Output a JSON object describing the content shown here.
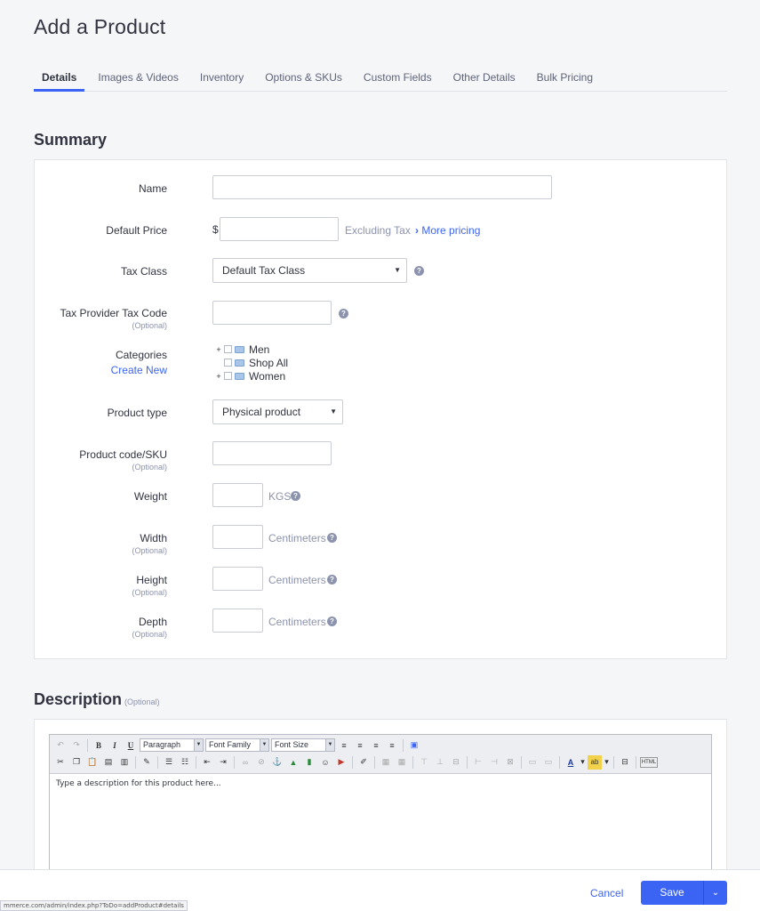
{
  "page": {
    "title": "Add a Product"
  },
  "tabs": [
    "Details",
    "Images & Videos",
    "Inventory",
    "Options & SKUs",
    "Custom Fields",
    "Other Details",
    "Bulk Pricing"
  ],
  "summary": {
    "title": "Summary",
    "name_label": "Name",
    "name_value": "",
    "price_label": "Default Price",
    "currency": "$",
    "price_value": "",
    "excluding_tax": "Excluding Tax",
    "more_pricing": "More pricing",
    "tax_class_label": "Tax Class",
    "tax_class_value": "Default Tax Class",
    "tax_code_label": "Tax Provider Tax Code",
    "optional": "(Optional)",
    "categories_label": "Categories",
    "create_new": "Create New",
    "categories": [
      {
        "name": "Men",
        "expandable": true
      },
      {
        "name": "Shop All",
        "expandable": false
      },
      {
        "name": "Women",
        "expandable": true
      }
    ],
    "product_type_label": "Product type",
    "product_type_value": "Physical product",
    "sku_label": "Product code/SKU",
    "weight_label": "Weight",
    "weight_unit": "KGS",
    "width_label": "Width",
    "height_label": "Height",
    "depth_label": "Depth",
    "dim_unit": "Centimeters"
  },
  "description": {
    "title": "Description",
    "optional": "(Optional)",
    "format_select": "Paragraph",
    "font_family_select": "Font Family",
    "font_size_select": "Font Size",
    "placeholder": "Type a description for this product here..."
  },
  "footer": {
    "cancel": "Cancel",
    "save": "Save"
  },
  "statusbar": {
    "url": "mmerce.com/admin/index.php?ToDo=addProduct#details"
  },
  "colors": {
    "accent": "#3c64f4",
    "text": "#313440",
    "muted": "#8c93ad"
  }
}
